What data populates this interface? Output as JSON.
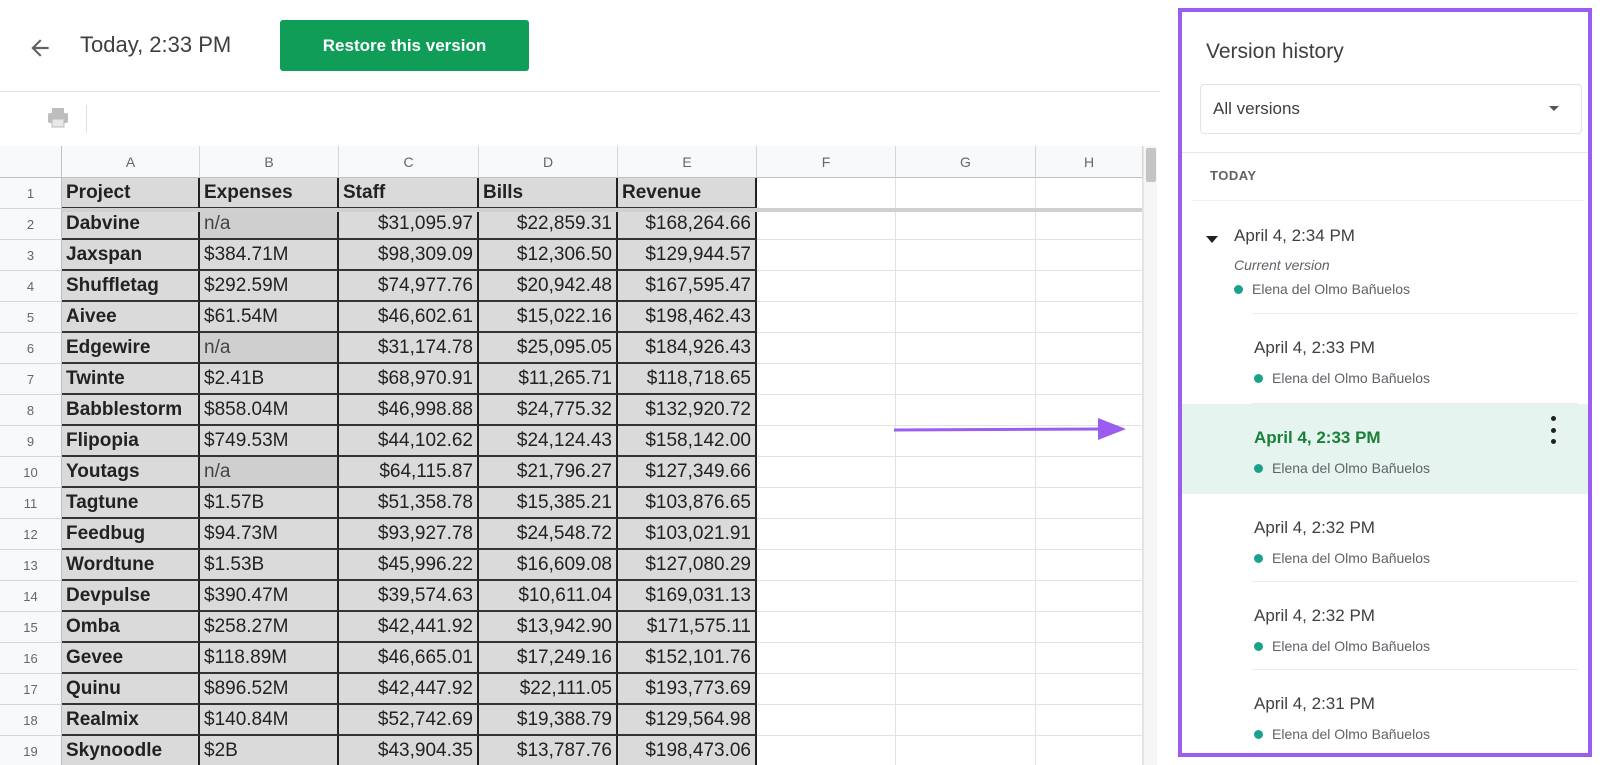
{
  "header": {
    "title": "Today, 2:33 PM",
    "restore_label": "Restore this version"
  },
  "sheet": {
    "columns": [
      "A",
      "B",
      "C",
      "D",
      "E",
      "F",
      "G",
      "H"
    ],
    "header_row": [
      "Project",
      "Expenses",
      "Staff",
      "Bills",
      "Revenue"
    ],
    "rows": [
      [
        "Dabvine",
        "n/a",
        "$31,095.97",
        "$22,859.31",
        "$168,264.66"
      ],
      [
        "Jaxspan",
        "$384.71M",
        "$98,309.09",
        "$12,306.50",
        "$129,944.57"
      ],
      [
        "Shuffletag",
        "$292.59M",
        "$74,977.76",
        "$20,942.48",
        "$167,595.47"
      ],
      [
        "Aivee",
        "$61.54M",
        "$46,602.61",
        "$15,022.16",
        "$198,462.43"
      ],
      [
        "Edgewire",
        "n/a",
        "$31,174.78",
        "$25,095.05",
        "$184,926.43"
      ],
      [
        "Twinte",
        "$2.41B",
        "$68,970.91",
        "$11,265.71",
        "$118,718.65"
      ],
      [
        "Babblestorm",
        "$858.04M",
        "$46,998.88",
        "$24,775.32",
        "$132,920.72"
      ],
      [
        "Flipopia",
        "$749.53M",
        "$44,102.62",
        "$24,124.43",
        "$158,142.00"
      ],
      [
        "Youtags",
        "n/a",
        "$64,115.87",
        "$21,796.27",
        "$127,349.66"
      ],
      [
        "Tagtune",
        "$1.57B",
        "$51,358.78",
        "$15,385.21",
        "$103,876.65"
      ],
      [
        "Feedbug",
        "$94.73M",
        "$93,927.78",
        "$24,548.72",
        "$103,021.91"
      ],
      [
        "Wordtune",
        "$1.53B",
        "$45,996.22",
        "$16,609.08",
        "$127,080.29"
      ],
      [
        "Devpulse",
        "$390.47M",
        "$39,574.63",
        "$10,611.04",
        "$169,031.13"
      ],
      [
        "Omba",
        "$258.27M",
        "$42,441.92",
        "$13,942.90",
        "$171,575.11"
      ],
      [
        "Gevee",
        "$118.89M",
        "$46,665.01",
        "$17,249.16",
        "$152,101.76"
      ],
      [
        "Quinu",
        "$896.52M",
        "$42,447.92",
        "$22,111.05",
        "$193,773.69"
      ],
      [
        "Realmix",
        "$140.84M",
        "$52,742.69",
        "$19,388.79",
        "$129,564.98"
      ],
      [
        "Skynoodle",
        "$2B",
        "$43,904.35",
        "$13,787.76",
        "$198,473.06"
      ]
    ]
  },
  "panel": {
    "title": "Version history",
    "filter_value": "All versions",
    "group_label": "TODAY",
    "versions": [
      {
        "time": "April 4, 2:34 PM",
        "note": "Current version",
        "author": "Elena del Olmo Bañuelos",
        "selected": false,
        "expanded": true
      },
      {
        "time": "April 4, 2:33 PM",
        "author": "Elena del Olmo Bañuelos",
        "selected": false
      },
      {
        "time": "April 4, 2:33 PM",
        "author": "Elena del Olmo Bañuelos",
        "selected": true
      },
      {
        "time": "April 4, 2:32 PM",
        "author": "Elena del Olmo Bañuelos",
        "selected": false
      },
      {
        "time": "April 4, 2:32 PM",
        "author": "Elena del Olmo Bañuelos",
        "selected": false
      },
      {
        "time": "April 4, 2:31 PM",
        "author": "Elena del Olmo Bañuelos",
        "selected": false
      }
    ]
  },
  "colors": {
    "accent_green": "#0f9d58",
    "selected_text_green": "#188038",
    "highlight_purple": "#9b5cf0",
    "author_dot": "#1aa38a"
  }
}
